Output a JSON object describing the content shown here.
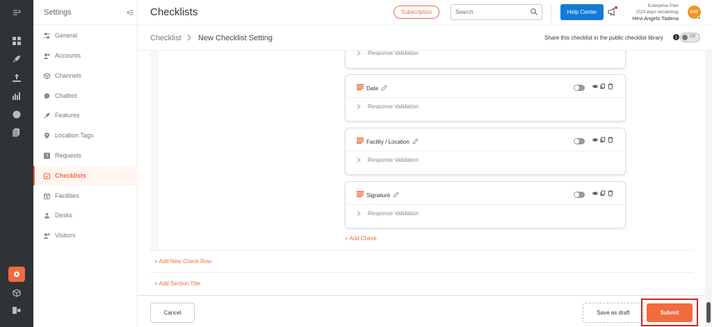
{
  "sidebar": {
    "title": "Settings",
    "items": [
      {
        "label": "General",
        "icon": "sliders-icon"
      },
      {
        "label": "Accounts",
        "icon": "users-icon"
      },
      {
        "label": "Channels",
        "icon": "cube-icon"
      },
      {
        "label": "Chatbot",
        "icon": "chat-icon"
      },
      {
        "label": "Features",
        "icon": "rocket-icon"
      },
      {
        "label": "Location Tags",
        "icon": "pin-icon"
      },
      {
        "label": "Requests",
        "icon": "question-icon"
      },
      {
        "label": "Checklists",
        "icon": "clipboard-icon"
      },
      {
        "label": "Facilities",
        "icon": "calendar-icon"
      },
      {
        "label": "Desks",
        "icon": "desk-icon"
      },
      {
        "label": "Visitors",
        "icon": "visitors-icon"
      }
    ],
    "active_index": 7
  },
  "header": {
    "title": "Checklists",
    "subscription_label": "Subscription",
    "search_placeholder": "Search",
    "help_label": "Help Center",
    "plan_name": "Enterprise Plan",
    "plan_remaining": "(523 days remaining)",
    "user_name": "Hevi Angelo Tadena",
    "avatar_initials": "HAT"
  },
  "breadcrumb": {
    "parent": "Checklist",
    "current": "New Checklist Setting",
    "share_label": "Share this checklist in the public checklist library",
    "share_toggle": "Off"
  },
  "checks": {
    "response_validation_label": "Response Validation",
    "items": [
      {
        "title": "Date"
      },
      {
        "title": "Facility / Location"
      },
      {
        "title": "Signature"
      }
    ],
    "add_check_label": "+ Add Check"
  },
  "section": {
    "add_row_label": "+ Add New Check Row",
    "add_title_label": "+ Add Section Title"
  },
  "footer": {
    "cancel_label": "Cancel",
    "draft_label": "Save as draft",
    "submit_label": "Submit"
  },
  "colors": {
    "accent": "#f26a3d",
    "help_blue": "#1479d8",
    "rail": "#2f3337",
    "highlight_red": "#d81e1e"
  }
}
